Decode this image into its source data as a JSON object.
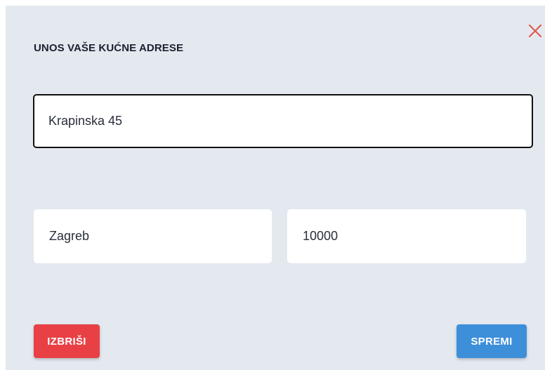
{
  "dialog": {
    "title": "UNOS VAŠE KUĆNE ADRESE",
    "close_icon": "close-icon",
    "street": {
      "value": "Krapinska 45",
      "placeholder": ""
    },
    "city": {
      "value": "Zagreb",
      "placeholder": ""
    },
    "postal_code": {
      "value": "10000",
      "placeholder": ""
    },
    "delete_label": "IZBRIŠI",
    "save_label": "SPREMI"
  },
  "colors": {
    "dialog_background": "#e4e9f0",
    "close_icon": "#e05a4f",
    "delete_button": "#e84045",
    "save_button": "#3d8fda",
    "focused_border": "#111111"
  }
}
